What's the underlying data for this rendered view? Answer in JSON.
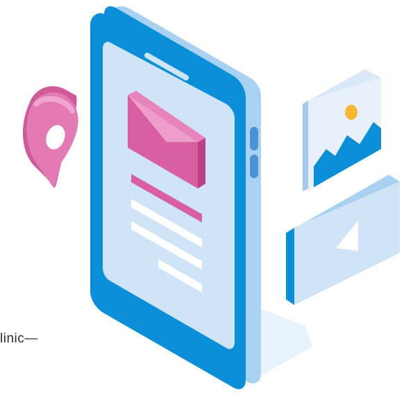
{
  "caption": {
    "text": "linic—"
  },
  "icons": {
    "location_pin": "location-pin-icon",
    "phone": "smartphone-icon",
    "envelope": "email-icon",
    "image": "image-icon",
    "video": "video-play-icon"
  },
  "colors": {
    "phone_blue": "#0a8fd8",
    "phone_side": "#a9d2f2",
    "screen": "#cfe5f7",
    "pink": "#d95ea2",
    "pink_light": "#ee9cc9",
    "pin_pink": "#e37ab4",
    "text_line": "#ffffff",
    "image_mountain": "#0a8fd8",
    "sun": "#f7b731",
    "shadow": "#e6f1fa"
  }
}
